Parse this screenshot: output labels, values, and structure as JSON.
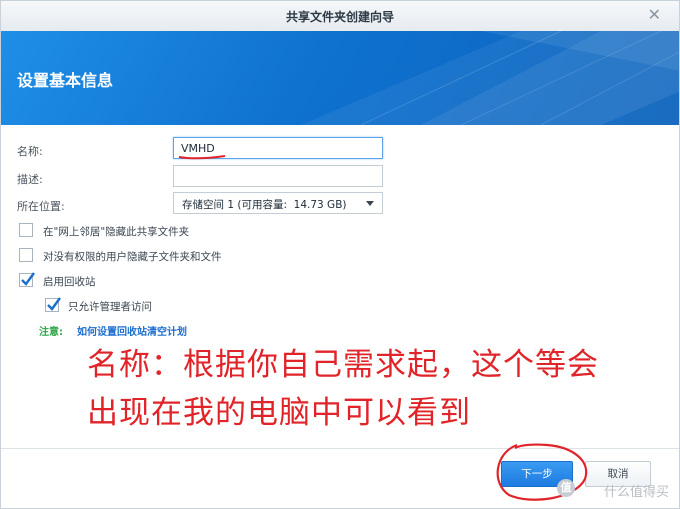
{
  "dialog": {
    "title": "共享文件夹创建向导",
    "close_glyph": "✕"
  },
  "header": {
    "title": "设置基本信息"
  },
  "form": {
    "name_label": "名称:",
    "name_value": "VMHD",
    "desc_label": "描述:",
    "desc_value": "",
    "location_label": "所在位置:",
    "location_value": "存储空间 1 (可用容量:  14.73 GB)"
  },
  "checkboxes": [
    {
      "label": "在\"网上邻居\"隐藏此共享文件夹",
      "checked": false
    },
    {
      "label": "对没有权限的用户隐藏子文件夹和文件",
      "checked": false
    },
    {
      "label": "启用回收站",
      "checked": true
    },
    {
      "label": "只允许管理者访问",
      "checked": true
    }
  ],
  "note": {
    "prefix": "注意:",
    "link": "如何设置回收站清空计划"
  },
  "annotation": {
    "line1": "名称：根据你自己需求起，这个等会",
    "line2": "出现在我的电脑中可以看到"
  },
  "buttons": {
    "next": "下一步",
    "cancel": "取消"
  },
  "watermark": {
    "icon_text": "值",
    "text": "什么值得买"
  },
  "colors": {
    "accent": "#1d7be2",
    "annotation": "#e0242a",
    "note_green": "#2ea34a"
  }
}
